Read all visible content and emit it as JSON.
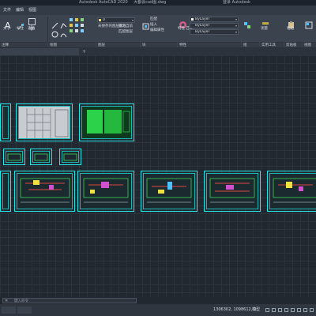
{
  "window": {
    "app_title": "Autodesk AutoCAD 2020",
    "file_name": "大都会cad图.dwg",
    "signin": "登录 Autodesk"
  },
  "menu": {
    "items": [
      "文件",
      "编辑",
      "视图"
    ]
  },
  "ribbon": {
    "text_label": "文字",
    "mark_label": "标注",
    "table_label": "表格",
    "annotate_label": "注释",
    "draw_label": "绘图",
    "modify_label": "修改",
    "layer_value": "0",
    "layer_tools": [
      "未保存的图层状态",
      "置为当前",
      "匹配图层"
    ],
    "layer_state_label": "图层",
    "layer_prop_items": [
      "匹配",
      "插入",
      "编辑属性"
    ],
    "block_label": "块",
    "color_value": "ByLayer",
    "linetype_value": "ByLayer",
    "lineweight_value": "ByLayer",
    "match_label": "特性\n匹配",
    "props_label": "特性",
    "groups_label": "组",
    "utilities_label": "实用工具",
    "clipboard_label": "剪贴板",
    "view_label": "视图",
    "measure_label": "测量",
    "paste_label": "粘贴",
    "basepoint_label": "基点"
  },
  "command": {
    "placeholder": "键入命令"
  },
  "status": {
    "coordinates": "1306302, 1098612, 0",
    "model_label": "模型"
  },
  "colors": {
    "sheet_border": "#25e6e6",
    "canvas_bg": "#212830",
    "ribbon_bg": "#3b434e"
  }
}
